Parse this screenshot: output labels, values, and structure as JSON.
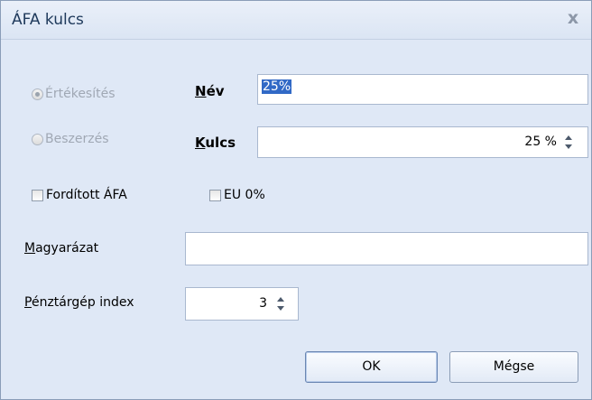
{
  "window": {
    "title": "ÁFA kulcs",
    "close_glyph": "x"
  },
  "radios": {
    "ertekesites": {
      "label": "Értékesítés",
      "checked": true,
      "enabled": false
    },
    "beszerzes": {
      "label": "Beszerzés",
      "checked": false,
      "enabled": false
    }
  },
  "nev": {
    "label_first": "N",
    "label_rest": "év",
    "value": "25%"
  },
  "kulcs": {
    "label_first": "K",
    "label_rest": "ulcs",
    "value": "25 %"
  },
  "checkboxes": {
    "forditott_afa": {
      "label": "Fordított ÁFA",
      "checked": false
    },
    "eu0": {
      "label": "EU 0%",
      "checked": false
    }
  },
  "magyarazat": {
    "label_first": "M",
    "label_rest": "agyarázat",
    "value": ""
  },
  "penztargep": {
    "label_first": "P",
    "label_rest": "énztárgép index",
    "value": "3"
  },
  "buttons": {
    "ok": "OK",
    "cancel": "Mégse"
  }
}
